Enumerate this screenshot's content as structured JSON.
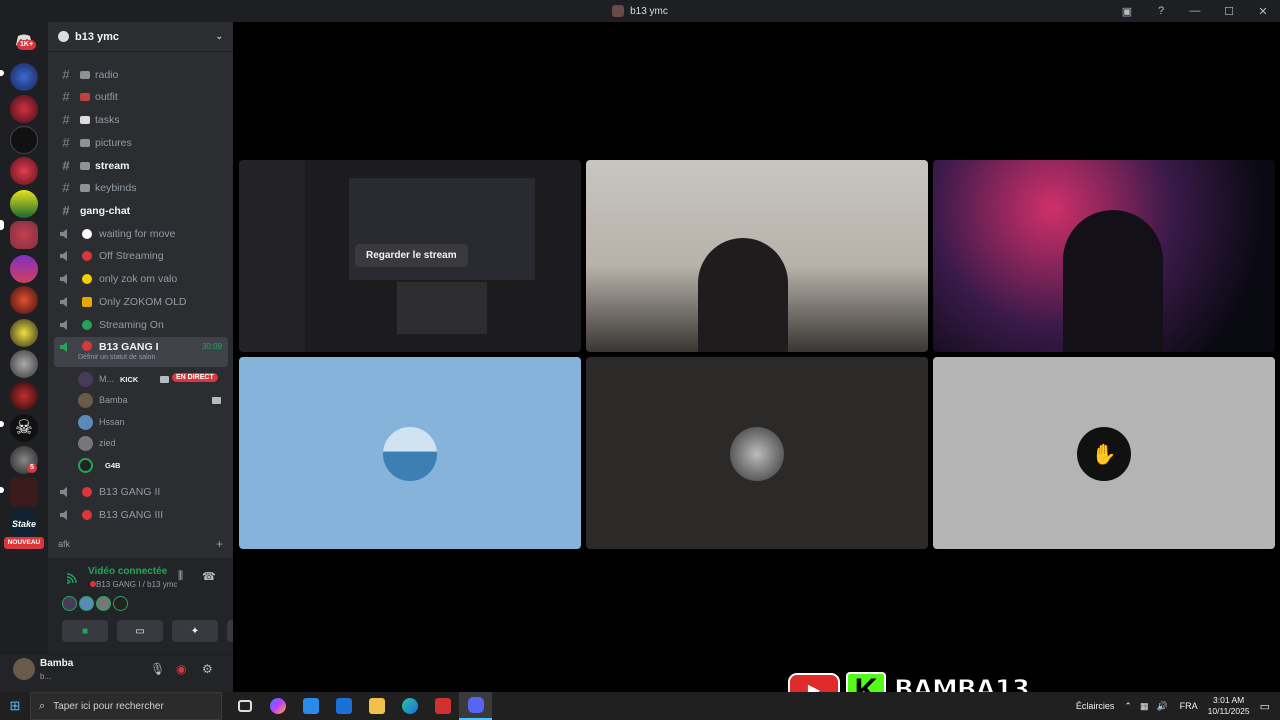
{
  "window": {
    "title": "b13 ymc"
  },
  "server": {
    "name": "b13 ymc"
  },
  "channels": [
    {
      "label": "radio",
      "type": "text"
    },
    {
      "label": "outfit",
      "type": "text"
    },
    {
      "label": "tasks",
      "type": "text"
    },
    {
      "label": "pictures",
      "type": "text"
    },
    {
      "label": "stream",
      "type": "text"
    },
    {
      "label": "keybinds",
      "type": "text"
    },
    {
      "label": "gang-chat",
      "type": "text"
    }
  ],
  "voice_channels": [
    {
      "label": "waiting for move",
      "dot": "#ffffff"
    },
    {
      "label": "Off Streaming",
      "dot": "#da373c"
    },
    {
      "label": "only zok om valo",
      "dot": "#f0d000"
    },
    {
      "label": "Only ZOKOM OLD",
      "dot": "#e6a800"
    },
    {
      "label": "Streaming On",
      "dot": "#23a559"
    }
  ],
  "active_channel": {
    "label": "B13 GANG I",
    "timer": "30:09",
    "status": "Définir un statut de salon"
  },
  "members": [
    {
      "name": "M...",
      "tag": "KICK",
      "live": "EN DIRECT"
    },
    {
      "name": "Bamba",
      "tag": ""
    },
    {
      "name": "Hssan",
      "tag": ""
    },
    {
      "name": "zied",
      "tag": ""
    },
    {
      "name": "",
      "tag": "G4B"
    }
  ],
  "more_channels": [
    {
      "label": "B13 GANG II"
    },
    {
      "label": "B13 GANG III"
    }
  ],
  "category": {
    "label": "afk"
  },
  "rail": {
    "top_badge": "1K+",
    "nouveau": "NOUVEAU",
    "badge5": "5"
  },
  "voice_panel": {
    "title": "Vidéo connectée",
    "sub": "B13 GANG I / b13 ymc"
  },
  "user": {
    "name": "Bamba",
    "sub": "b..."
  },
  "stage": {
    "watch_label": "Regarder le stream"
  },
  "overlay": {
    "name": "BAMBA13",
    "k": "K"
  },
  "taskbar": {
    "search_placeholder": "Taper ici pour rechercher",
    "weather": "Éclaircies",
    "lang": "FRA",
    "time": "3:01 AM",
    "date": "10/11/2025"
  }
}
